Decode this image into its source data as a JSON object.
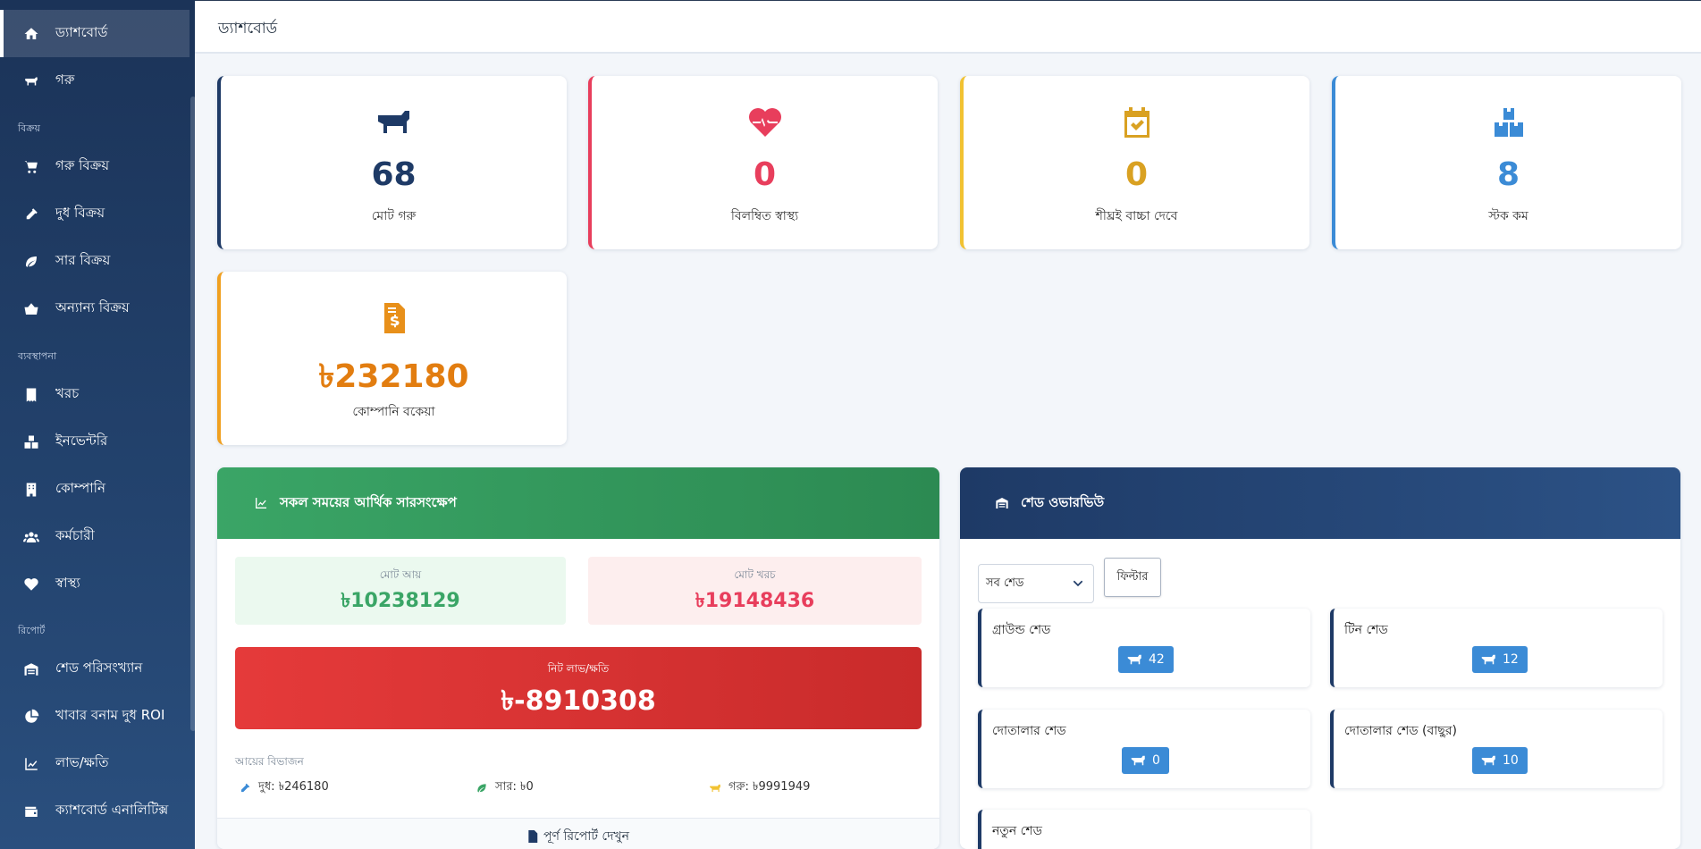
{
  "colors": {
    "sidebar_bg": "#1b3358",
    "cattle_accent": "#1e3a66",
    "health_accent": "#e83e5c",
    "calving_accent": "#f1c232",
    "stock_accent": "#3b8bd6",
    "due_accent": "#f0a020",
    "income_green": "#3aa566",
    "expense_red": "#e83e5c",
    "net_red": "#dc3535"
  },
  "sidebar": {
    "items": [
      {
        "label": "ড্যাশবোর্ড",
        "icon": "home-icon"
      },
      {
        "label": "গরু",
        "icon": "cow-icon"
      },
      {
        "label": "গরু বিক্রয়",
        "icon": "cart-icon"
      },
      {
        "label": "দুধ বিক্রয়",
        "icon": "bottle-icon"
      },
      {
        "label": "সার বিক্রয়",
        "icon": "leaf-icon"
      },
      {
        "label": "অন্যান্য বিক্রয়",
        "icon": "basket-icon"
      },
      {
        "label": "খরচ",
        "icon": "receipt-icon"
      },
      {
        "label": "ইনভেন্টরি",
        "icon": "boxes-icon"
      },
      {
        "label": "কোম্পানি",
        "icon": "building-icon"
      },
      {
        "label": "কর্মচারী",
        "icon": "users-icon"
      },
      {
        "label": "স্বাস্থ্য",
        "icon": "heartbeat-icon"
      },
      {
        "label": "শেড পরিসংখ্যান",
        "icon": "warehouse-icon"
      },
      {
        "label": "খাবার বনাম দুধ ROI",
        "icon": "pie-icon"
      },
      {
        "label": "লাভ/ক্ষতি",
        "icon": "chart-line-icon"
      },
      {
        "label": "ক্যাশবোর্ড এনালিটিক্স",
        "icon": "wallet-icon"
      }
    ],
    "sections": [
      "বিক্রয়",
      "ব্যবস্থাপনা",
      "রিপোর্ট"
    ]
  },
  "header": {
    "title": "ড্যাশবোর্ড"
  },
  "stats": [
    {
      "value": "68",
      "label": "মোট গরু",
      "icon": "cow-icon"
    },
    {
      "value": "0",
      "label": "বিলম্বিত স্বাস্থ্য",
      "icon": "heartbeat-icon"
    },
    {
      "value": "0",
      "label": "শীঘ্রই বাচ্চা দেবে",
      "icon": "calendar-check-icon"
    },
    {
      "value": "8",
      "label": "স্টক কম",
      "icon": "boxes-icon"
    },
    {
      "value": "৳232180",
      "label": "কোম্পানি বকেয়া",
      "icon": "invoice-dollar-icon"
    }
  ],
  "finance": {
    "title": "সকল সময়ের আর্থিক সারসংক্ষেপ",
    "income_label": "মোট আয়",
    "income_value": "৳10238129",
    "expense_label": "মোট খরচ",
    "expense_value": "৳19148436",
    "net_label": "নিট লাভ/ক্ষতি",
    "net_value": "৳-8910308",
    "breakdown_title": "আয়ের বিভাজন",
    "breakdown": [
      {
        "text": "দুধ: ৳246180",
        "icon": "bottle-icon"
      },
      {
        "text": "সার: ৳0",
        "icon": "leaf-icon"
      },
      {
        "text": "গরু: ৳9991949",
        "icon": "cow-icon"
      }
    ],
    "footer_link": "পূর্ণ রিপোর্ট দেখুন"
  },
  "sheds": {
    "title": "শেড ওভারভিউ",
    "select_value": "সব শেড",
    "filter_label": "ফিল্টার",
    "items": [
      {
        "name": "গ্রাউন্ড শেড",
        "count": "42"
      },
      {
        "name": "টিন শেড",
        "count": "12"
      },
      {
        "name": "দোতালার শেড",
        "count": "0"
      },
      {
        "name": "দোতালার শেড (বাছুর)",
        "count": "10"
      },
      {
        "name": "নতুন শেড",
        "count": ""
      }
    ]
  }
}
